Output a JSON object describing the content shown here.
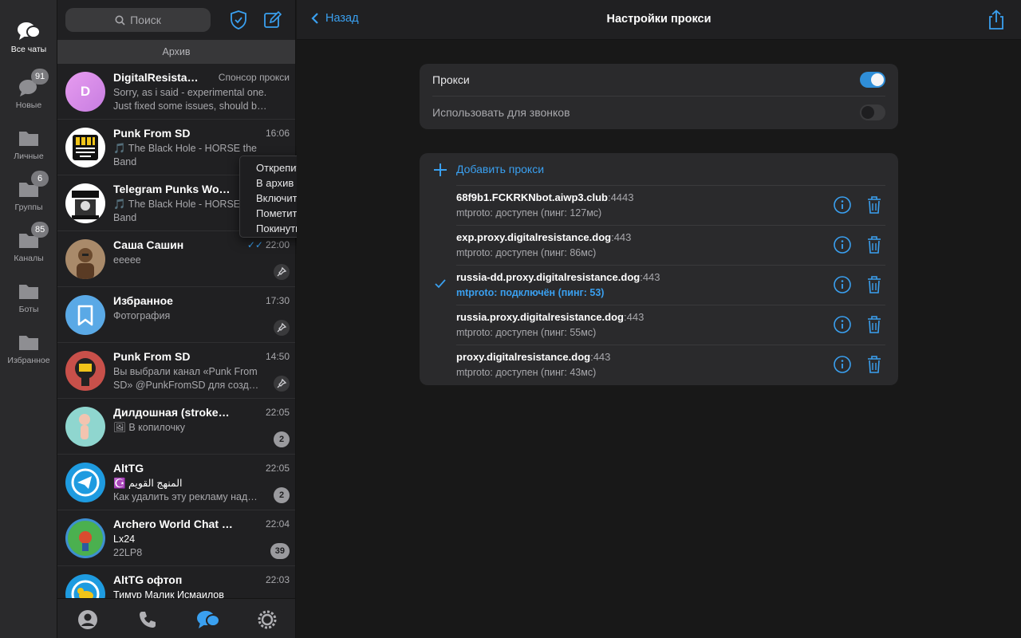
{
  "rail": {
    "folders": [
      {
        "label": "Все чаты",
        "icon": "chats-icon",
        "badge": ""
      },
      {
        "label": "Новые",
        "icon": "chat-bubble-icon",
        "badge": "91"
      },
      {
        "label": "Личные",
        "icon": "folder-icon",
        "badge": ""
      },
      {
        "label": "Группы",
        "icon": "folder-icon",
        "badge": "6"
      },
      {
        "label": "Каналы",
        "icon": "folder-icon",
        "badge": "85"
      },
      {
        "label": "Боты",
        "icon": "folder-icon",
        "badge": ""
      },
      {
        "label": "Избранное",
        "icon": "folder-icon",
        "badge": ""
      }
    ]
  },
  "list": {
    "search_placeholder": "Поиск",
    "archive_label": "Архив",
    "chats": [
      {
        "name": "DigitalResistan…",
        "time": "Спонсор прокси",
        "line1": "Sorry, as i said - experimental one.",
        "line2": "Just fixed some issues, should b…",
        "avatar_letter": "D"
      },
      {
        "name": "Punk From SD",
        "time": "16:06",
        "line1": "🎵 The Black Hole - HORSE the",
        "line2": "Band"
      },
      {
        "name": "Telegram Punks World…",
        "time": "",
        "line1": "🎵 The Black Hole - HORSE",
        "line2": "Band"
      },
      {
        "name": "Саша Сашин",
        "time": "22:00",
        "line1": "eeeee",
        "line2": ""
      },
      {
        "name": "Избранное",
        "time": "17:30",
        "line1": "Фотография",
        "line2": ""
      },
      {
        "name": "Punk From SD",
        "time": "14:50",
        "line1": "Вы выбрали канал «Punk From",
        "line2": "SD» @PunkFromSD для созд…"
      },
      {
        "name": "Дилдошная (strokes b…",
        "time": "22:05",
        "line1": "🖼 В копилочку",
        "line2": "",
        "badge": "2"
      },
      {
        "name": "AltTG",
        "time": "22:05",
        "line1": "☪️ المنهج القويم",
        "line2": "Как удалить эту рекламу над…",
        "badge": "2"
      },
      {
        "name": "Archero World Chat 🏹",
        "time": "22:04",
        "line1": "Lx24",
        "line2": "22LP8",
        "badge": "39"
      },
      {
        "name": "AltTG офтоп",
        "time": "22:03",
        "line1": "Тимур Малик Исмаилов",
        "line2": ""
      }
    ]
  },
  "context_menu": {
    "items": [
      "Открепить",
      "В архив",
      "Включить уведомления",
      "Пометить как непрочитанное",
      "Покинуть канал"
    ]
  },
  "pane": {
    "back_label": "Назад",
    "title": "Настройки прокси",
    "proxy_label": "Прокси",
    "proxy_on": true,
    "calls_label": "Использовать для звонков",
    "calls_on": false,
    "add_label": "Добавить прокси",
    "proxies": [
      {
        "host": "68f9b1.FCKRKNbot.aiwp3.club",
        "port": ":4443",
        "status": "mtproto: доступен (пинг: 127мс)",
        "selected": false
      },
      {
        "host": "exp.proxy.digitalresistance.dog",
        "port": ":443",
        "status": "mtproto: доступен (пинг: 86мс)",
        "selected": false
      },
      {
        "host": "russia-dd.proxy.digitalresistance.dog",
        "port": ":443",
        "status": "mtproto: подключён (пинг: 53)",
        "selected": true
      },
      {
        "host": "russia.proxy.digitalresistance.dog",
        "port": ":443",
        "status": "mtproto: доступен (пинг: 55мс)",
        "selected": false
      },
      {
        "host": "proxy.digitalresistance.dog",
        "port": ":443",
        "status": "mtproto: доступен (пинг: 43мс)",
        "selected": false
      }
    ]
  },
  "colors": {
    "accent": "#3aa0f0",
    "background": "#181818",
    "panel": "#2a2a2c"
  }
}
